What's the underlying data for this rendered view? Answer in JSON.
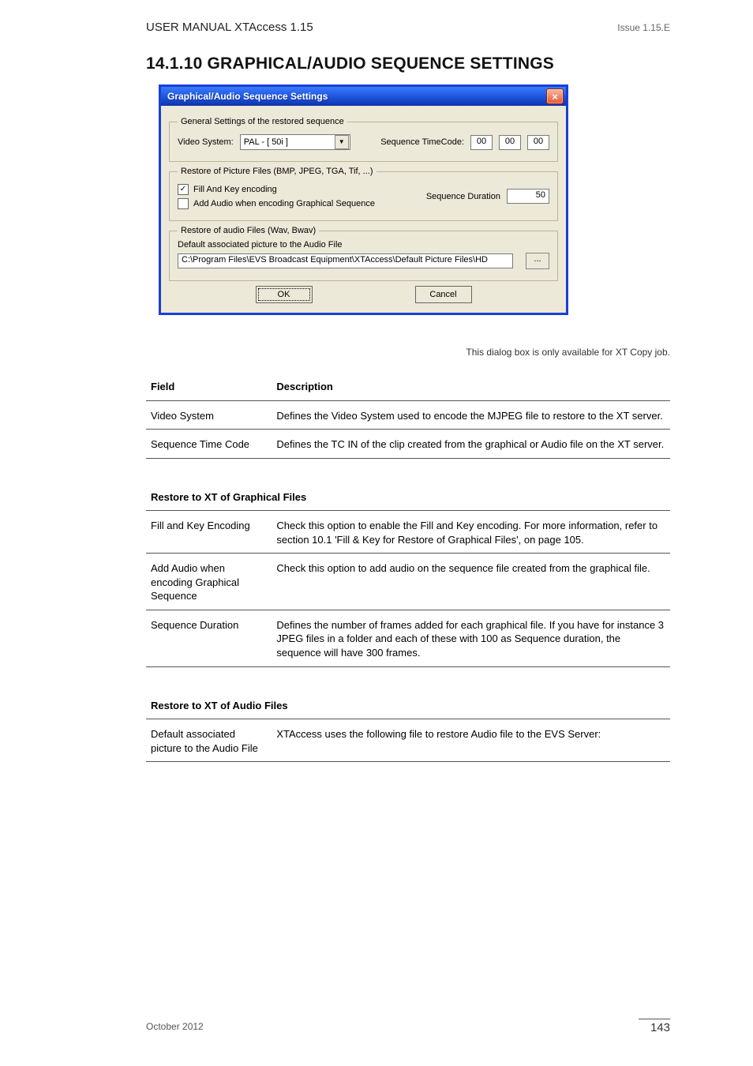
{
  "header": {
    "category": "USER MANUAL XTAccess 1.15",
    "issue_right": "Issue 1.15.E"
  },
  "dialog": {
    "title": "Graphical/Audio Sequence Settings",
    "close": "×",
    "group1": {
      "legend": "General Settings of the restored sequence",
      "video_system_label": "Video System:",
      "video_system_value": "PAL - [ 50i ]",
      "combo_arrow": "▼",
      "tc_label": "Sequence TimeCode:",
      "tc_hh": "00",
      "tc_mm": "00",
      "tc_ss": "00"
    },
    "group2": {
      "legend": "Restore of Picture Files (BMP, JPEG, TGA, Tif, ...)",
      "cb_fill": "Fill And Key encoding",
      "cb_fill_checked": "✓",
      "cb_audio": "Add Audio when encoding Graphical Sequence",
      "dur_label": "Sequence Duration",
      "dur_value": "50"
    },
    "group3": {
      "legend": "Restore of audio Files (Wav, Bwav)",
      "picture_label": "Default associated picture to the Audio File",
      "path": "C:\\Program Files\\EVS Broadcast Equipment\\XTAccess\\Default Picture Files\\HD",
      "browse": "..."
    },
    "ok": "OK",
    "cancel": "Cancel"
  },
  "section": {
    "title": "14.1.10 GRAPHICAL/AUDIO SEQUENCE SETTINGS",
    "note": "This dialog box is only available for XT Copy job."
  },
  "table1": {
    "head_l": "Field",
    "head_r": "Description",
    "rows": [
      {
        "l": "Video System",
        "r": "Defines the Video System used to encode the MJPEG file to restore to the XT server."
      },
      {
        "l": "Sequence Time Code",
        "r": "Defines the TC IN of the clip created from the graphical or Audio file on the XT server."
      }
    ]
  },
  "table2": {
    "groupTitle": "Restore to XT of Graphical Files",
    "rows": [
      {
        "l": "Fill and Key Encoding",
        "r": "Check this option to enable the Fill and Key encoding. For more information, refer to section 10.1 'Fill & Key for Restore of Graphical Files', on page 105."
      },
      {
        "l": "Add Audio when encoding Graphical Sequence",
        "r": "Check this option to add audio on the sequence file created from the graphical file."
      },
      {
        "l": "Sequence Duration",
        "r": "Defines the number of frames added for each graphical file. If you have for instance 3 JPEG files in a folder and each of these with 100 as Sequence duration, the sequence will have 300 frames."
      }
    ]
  },
  "table3": {
    "groupTitle": "Restore to XT of Audio Files",
    "rows": [
      {
        "l": "Default associated picture to the Audio File",
        "r": "XTAccess uses the following file to restore Audio file to the EVS Server:"
      }
    ]
  },
  "footer": {
    "left": "October 2012",
    "page": "143"
  }
}
